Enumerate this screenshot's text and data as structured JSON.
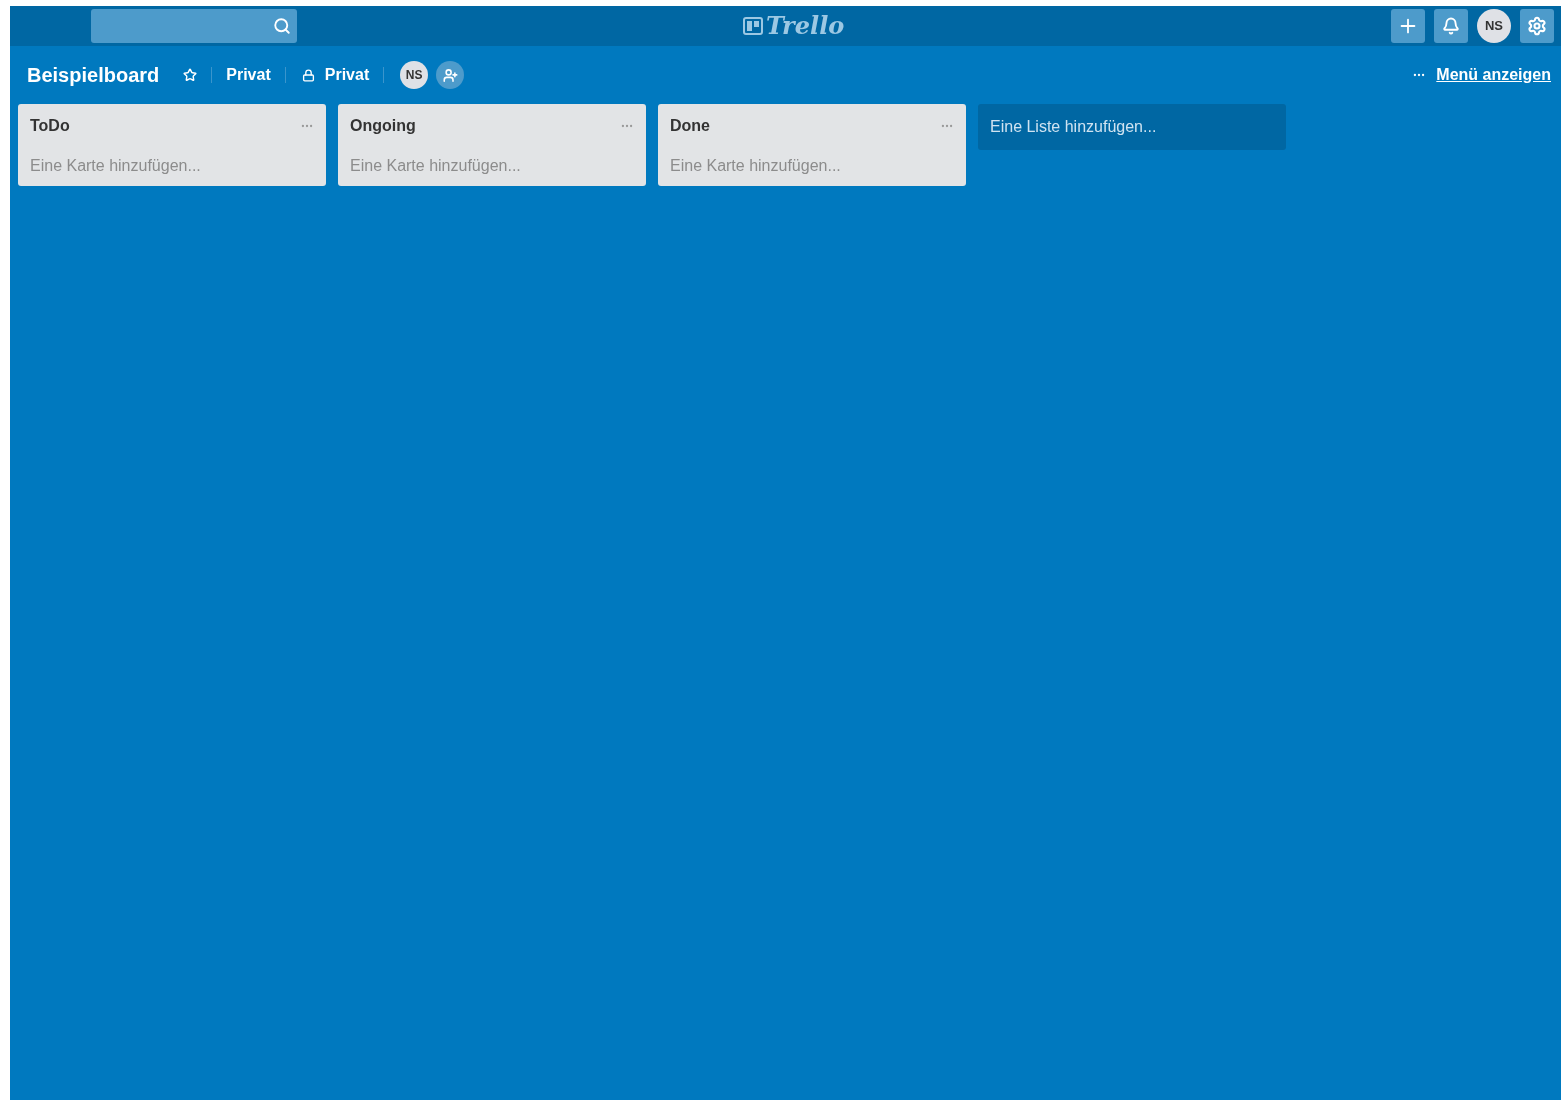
{
  "header": {
    "logo": "Trello",
    "avatar": "NS"
  },
  "board_bar": {
    "title": "Beispielboard",
    "team": "Privat",
    "visibility": "Privat",
    "member": "NS",
    "menu_link": "Menü anzeigen"
  },
  "lists": [
    {
      "title": "ToDo",
      "add_card": "Eine Karte hinzufügen..."
    },
    {
      "title": "Ongoing",
      "add_card": "Eine Karte hinzufügen..."
    },
    {
      "title": "Done",
      "add_card": "Eine Karte hinzufügen..."
    }
  ],
  "add_list": "Eine Liste hinzufügen..."
}
